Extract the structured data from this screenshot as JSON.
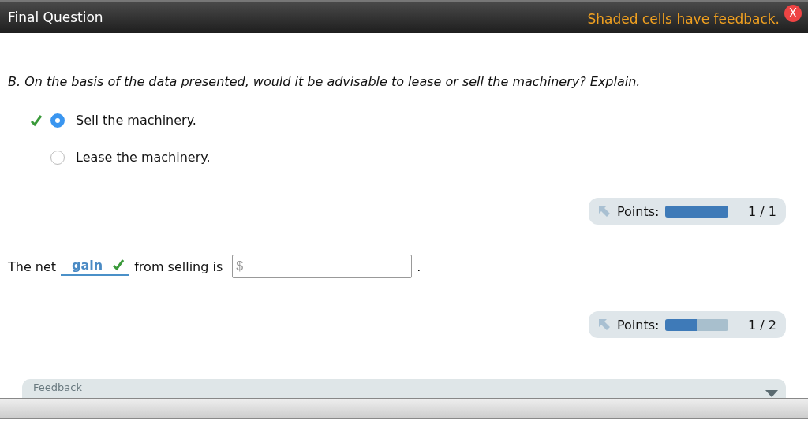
{
  "header": {
    "title": "Final Question",
    "notice": "Shaded cells have feedback.",
    "close": "X"
  },
  "question": {
    "text": "B. On the basis of the data presented, would it be advisable to lease or sell the machinery? Explain.",
    "options": [
      {
        "label": "Sell the machinery.",
        "selected": true,
        "correct": true
      },
      {
        "label": "Lease the machinery.",
        "selected": false,
        "correct": false
      }
    ]
  },
  "points_1": {
    "label": "Points:",
    "level": 1,
    "score": "1 / 1"
  },
  "sentence": {
    "before": "The net",
    "answer": "gain",
    "correct": true,
    "after": "from selling is",
    "field": {
      "placeholder": "$"
    },
    "end": "."
  },
  "points_2": {
    "label": "Points:",
    "level": 0.5,
    "score": "1 / 2"
  },
  "feedback": {
    "title": "Feedback",
    "expanded": false
  }
}
